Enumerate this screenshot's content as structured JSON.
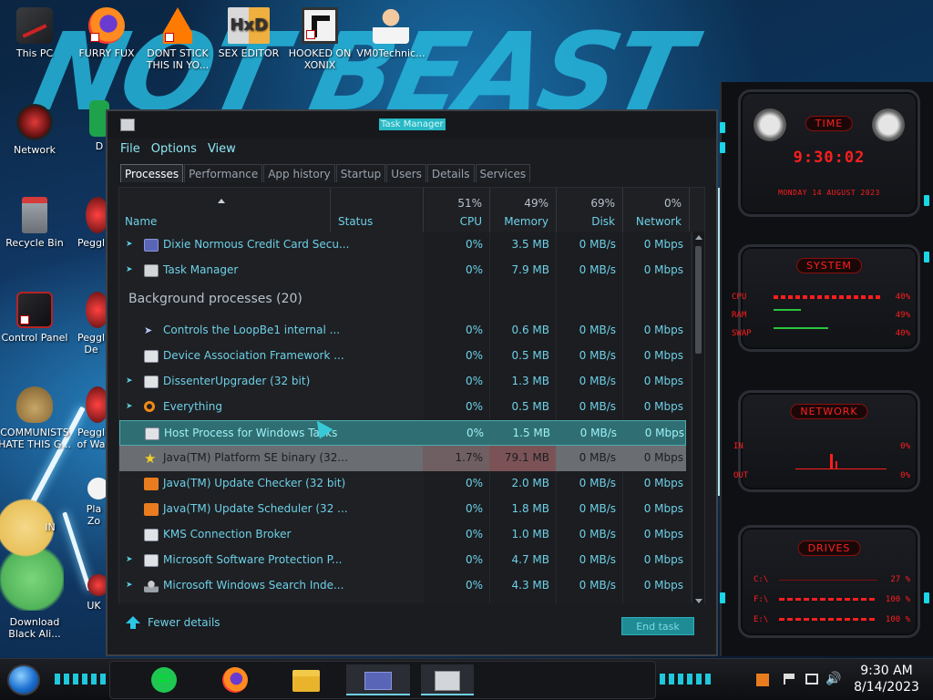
{
  "desktop": {
    "wallpaper_text": "NOT BEAST",
    "icons": [
      {
        "label": "This PC"
      },
      {
        "label": "FURRY FUX"
      },
      {
        "label": "DONT STICK THIS IN YO..."
      },
      {
        "label": "SEX EDITOR"
      },
      {
        "label": "HOOKED ON XONIX"
      },
      {
        "label": "VM0Technic..."
      },
      {
        "label": "Network"
      },
      {
        "label": "Recycle Bin"
      },
      {
        "label": "Control Panel"
      },
      {
        "label": "COMMUNISTS HATE THIS G..."
      },
      {
        "label": "Download Black Ali..."
      },
      {
        "label": "D DU"
      },
      {
        "label": "Peggl"
      },
      {
        "label": "Peggl De"
      },
      {
        "label": "Peggl of Wa"
      },
      {
        "label": "IN"
      },
      {
        "label": "Pla Zo"
      },
      {
        "label": "UK"
      }
    ]
  },
  "task_manager": {
    "title": "Task Manager",
    "menu": [
      "File",
      "Options",
      "View"
    ],
    "tabs": [
      "Processes",
      "Performance",
      "App history",
      "Startup",
      "Users",
      "Details",
      "Services"
    ],
    "active_tab": "Processes",
    "columns": {
      "name": "Name",
      "status": "Status",
      "cpu": {
        "label": "CPU",
        "pct": "51%"
      },
      "memory": {
        "label": "Memory",
        "pct": "49%"
      },
      "disk": {
        "label": "Disk",
        "pct": "69%"
      },
      "network": {
        "label": "Network",
        "pct": "0%"
      }
    },
    "apps": [
      {
        "name": "Dixie Normous Credit Card Secu...",
        "cpu": "0%",
        "memory": "3.5 MB",
        "disk": "0 MB/s",
        "network": "0 Mbps",
        "expand": true
      },
      {
        "name": "Task Manager",
        "cpu": "0%",
        "memory": "7.9 MB",
        "disk": "0 MB/s",
        "network": "0 Mbps",
        "expand": true
      }
    ],
    "background_group": "Background processes (20)",
    "background": [
      {
        "name": "Controls the LoopBe1 internal ...",
        "cpu": "0%",
        "memory": "0.6 MB",
        "disk": "0 MB/s",
        "network": "0 Mbps",
        "expand": false
      },
      {
        "name": "Device Association Framework ...",
        "cpu": "0%",
        "memory": "0.5 MB",
        "disk": "0 MB/s",
        "network": "0 Mbps",
        "expand": false
      },
      {
        "name": "DissenterUpgrader (32 bit)",
        "cpu": "0%",
        "memory": "1.3 MB",
        "disk": "0 MB/s",
        "network": "0 Mbps",
        "expand": true
      },
      {
        "name": "Everything",
        "cpu": "0%",
        "memory": "0.5 MB",
        "disk": "0 MB/s",
        "network": "0 Mbps",
        "expand": true
      },
      {
        "name": "Host Process for Windows Tasks",
        "cpu": "0%",
        "memory": "1.5 MB",
        "disk": "0 MB/s",
        "network": "0 Mbps",
        "expand": false
      },
      {
        "name": "Java(TM) Platform SE binary (32...",
        "cpu": "1.7%",
        "memory": "79.1 MB",
        "disk": "0 MB/s",
        "network": "0 Mbps",
        "expand": false
      },
      {
        "name": "Java(TM) Update Checker (32 bit)",
        "cpu": "0%",
        "memory": "2.0 MB",
        "disk": "0 MB/s",
        "network": "0 Mbps",
        "expand": false
      },
      {
        "name": "Java(TM) Update Scheduler (32 ...",
        "cpu": "0%",
        "memory": "1.8 MB",
        "disk": "0 MB/s",
        "network": "0 Mbps",
        "expand": false
      },
      {
        "name": "KMS Connection Broker",
        "cpu": "0%",
        "memory": "1.0 MB",
        "disk": "0 MB/s",
        "network": "0 Mbps",
        "expand": false
      },
      {
        "name": "Microsoft Software Protection P...",
        "cpu": "0%",
        "memory": "4.7 MB",
        "disk": "0 MB/s",
        "network": "0 Mbps",
        "expand": true
      },
      {
        "name": "Microsoft Windows Search Inde...",
        "cpu": "0%",
        "memory": "4.3 MB",
        "disk": "0 MB/s",
        "network": "0 Mbps",
        "expand": true
      }
    ],
    "fewer_details": "Fewer details",
    "end_task": "End task"
  },
  "gadget": {
    "time_title": "TIME",
    "time": "9:30:02",
    "date": "MONDAY 14 AUGUST 2023",
    "system_title": "SYSTEM",
    "cpu_label": "CPU",
    "cpu_val": "40%",
    "ram_label": "RAM",
    "ram_val": "49%",
    "swap_label": "SWAP",
    "swap_val": "40%",
    "network_title": "NETWORK",
    "in_label": "IN",
    "in_val": "0%",
    "out_label": "OUT",
    "out_val": "0%",
    "drives_title": "DRIVES",
    "drives": [
      {
        "label": "C:\\",
        "val": "27 %"
      },
      {
        "label": "F:\\",
        "val": "100 %"
      },
      {
        "label": "E:\\",
        "val": "100 %"
      }
    ]
  },
  "taskbar": {
    "time": "9:30 AM",
    "date": "8/14/2023",
    "apps": [
      "start-orb",
      "chat-app",
      "firefox",
      "file-explorer",
      "credit-card-app",
      "task-manager"
    ]
  },
  "colors": {
    "accent": "#28b9c5",
    "link": "#6ed0e6",
    "gadget_red": "#ff1e1e"
  }
}
